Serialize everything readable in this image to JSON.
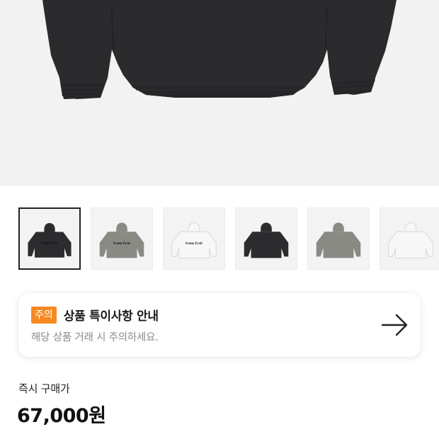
{
  "product": {
    "hero_image": "black-hoodie-back-view",
    "thumbnails": [
      {
        "image": "black-hoodie-front",
        "color": "#2c2c2e",
        "print": "Scuna Ectir",
        "selected": true
      },
      {
        "image": "gray-hoodie-front",
        "color": "#8a8a85",
        "print": "Scuna Ectir",
        "selected": false
      },
      {
        "image": "white-hoodie-front",
        "color": "#f7f7f7",
        "print": "Scuna Ectir",
        "selected": false
      },
      {
        "image": "black-hoodie-back",
        "color": "#2c2c2e",
        "print": "",
        "selected": false
      },
      {
        "image": "gray-hoodie-back",
        "color": "#8a8a85",
        "print": "",
        "selected": false
      },
      {
        "image": "white-hoodie-back",
        "color": "#f7f7f7",
        "print": "",
        "selected": false
      }
    ]
  },
  "notice": {
    "badge": "주의",
    "title": "상품 특이사항 안내",
    "subtitle": "해당 상품 거래 시 주의하세요.",
    "arrow_icon": "arrow-right-icon",
    "badge_color": "#f58a23"
  },
  "price": {
    "label": "즉시 구매가",
    "value": "67,000원"
  }
}
